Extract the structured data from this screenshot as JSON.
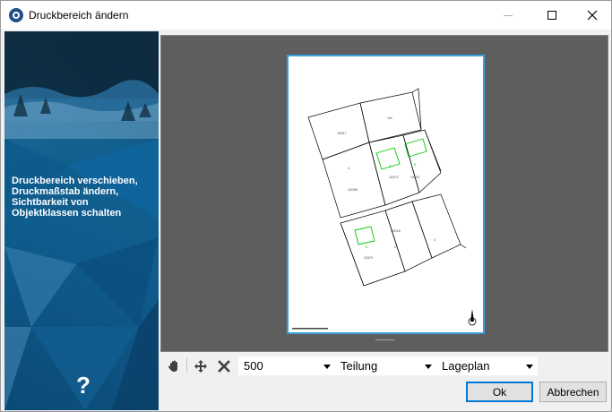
{
  "window": {
    "title": "Druckbereich ändern",
    "icon": "app-logo-icon"
  },
  "left_panel": {
    "lines": [
      "Druckbereich verschieben,",
      "Druckmaßstab ändern,",
      "Sichtbarkeit von",
      "Objektklassen schalten"
    ],
    "help": "?"
  },
  "toolbar": {
    "scale_value": "500",
    "split_value": "Teilung",
    "plan_value": "Lageplan",
    "icons": [
      "hand-pan-icon",
      "move-arrows-icon",
      "delete-x-icon"
    ]
  },
  "buttons": {
    "ok_label": "Ok",
    "cancel_label": "Abbrechen"
  },
  "colors": {
    "accent": "#0078d7",
    "sheet_border": "#3aa0d8",
    "preview_bg": "#5e5e5e",
    "parcel_highlight": "#00c800"
  }
}
